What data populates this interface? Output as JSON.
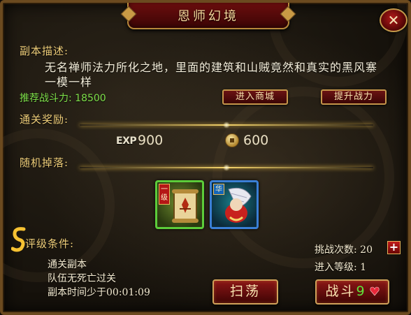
{
  "title": "恩师幻境",
  "close_label": "✕",
  "description": {
    "label": "副本描述:",
    "text": "无名禅师法力所化之地，里面的建筑和山贼竟然和真实的黑风寨一模一样"
  },
  "power": {
    "label": "推荐战斗力:",
    "value": "18500"
  },
  "buttons": {
    "shop": "进入商城",
    "boost": "提升战力",
    "sweep": "扫荡",
    "battle": "战斗",
    "battle_count": "9"
  },
  "rewards": {
    "label": "通关奖励:",
    "exp_tag": "EXP",
    "exp_value": "900",
    "coin_value": "600"
  },
  "drops": {
    "label": "随机掉落:",
    "items": [
      {
        "badge": "一级",
        "icon": "scroll-icon",
        "quality": "green"
      },
      {
        "badge": "华",
        "icon": "fan-icon",
        "quality": "blue"
      }
    ]
  },
  "rating": {
    "label": "评级条件:",
    "conditions": [
      "通关副本",
      "队伍无死亡过关",
      "副本时间少于00:01:09"
    ]
  },
  "challenge": {
    "label": "挑战次数:",
    "value": "20"
  },
  "level": {
    "label": "进入等级:",
    "value": "1"
  },
  "colors": {
    "gold_text": "#f0cf7a",
    "green_text": "#7fe04a",
    "button_red": "#6a1313",
    "frame": "#6b4a1f"
  }
}
